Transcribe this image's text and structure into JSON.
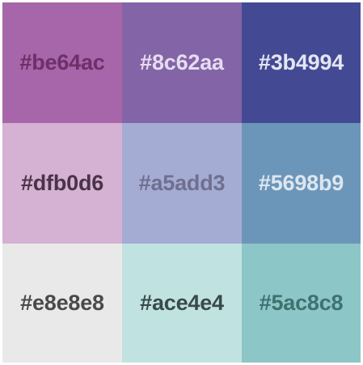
{
  "swatches": [
    {
      "label": "#be64ac",
      "bg": "#a766a9",
      "text": "#6d3068"
    },
    {
      "label": "#8c62aa",
      "bg": "#8264a7",
      "text": "#e6dcf0"
    },
    {
      "label": "#3b4994",
      "bg": "#434a93",
      "text": "#e3e6f3"
    },
    {
      "label": "#dfb0d6",
      "bg": "#d5b1d3",
      "text": "#4a3347"
    },
    {
      "label": "#a5add3",
      "bg": "#a5acd3",
      "text": "#6f6f8f"
    },
    {
      "label": "#5698b9",
      "bg": "#6c96b9",
      "text": "#dce6f0"
    },
    {
      "label": "#e8e8e8",
      "bg": "#e9e9e9",
      "text": "#4a4a4a"
    },
    {
      "label": "#ace4e4",
      "bg": "#c0e3e2",
      "text": "#3a4a4a"
    },
    {
      "label": "#5ac8c8",
      "bg": "#8cc6c6",
      "text": "#3f7170"
    }
  ]
}
